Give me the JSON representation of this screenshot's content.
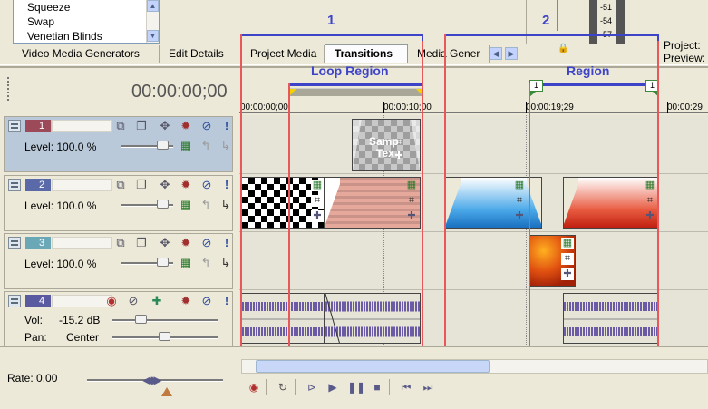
{
  "transitions_list": {
    "items": [
      "Squeeze",
      "Swap",
      "Venetian Blinds"
    ]
  },
  "tabs": [
    {
      "label": "Video Media Generators"
    },
    {
      "label": "Edit Details"
    },
    {
      "label": "Project Media"
    },
    {
      "label": "Transitions"
    },
    {
      "label": "Media Gener"
    }
  ],
  "meter_labels": [
    "-51",
    "-54",
    "-57"
  ],
  "project_labels": {
    "project": "Project:",
    "preview": "Preview:"
  },
  "annotations": {
    "num1": "1",
    "num2": "2",
    "loop_region": "Loop Region",
    "region": "Region"
  },
  "timecode": "00:00:00;00",
  "ruler": {
    "t0": "00:00:00;00",
    "t1": "00:00:10;00",
    "t2": "00:00:19;29",
    "t3": "00:00:29"
  },
  "region_markers": [
    "1",
    "1"
  ],
  "tracks": [
    {
      "number": "1",
      "level_label": "Level: 100.0 %"
    },
    {
      "number": "2",
      "level_label": "Level: 100.0 %"
    },
    {
      "number": "3",
      "level_label": "Level: 100.0 %"
    },
    {
      "number": "4",
      "vol_label": "Vol:",
      "vol_value": "-15.2 dB",
      "pan_label": "Pan:",
      "pan_value": "Center"
    }
  ],
  "clip_text": {
    "sample": "Samp",
    "text": "Tex"
  },
  "rate": "Rate: 0.00",
  "colors": {
    "accent_blue": "#3e44c8",
    "region_red": "#e8575a",
    "track1": "#9c4a5a",
    "track2": "#5a6aa8",
    "track3": "#6aa8b8",
    "track4": "#5a5aa0"
  }
}
